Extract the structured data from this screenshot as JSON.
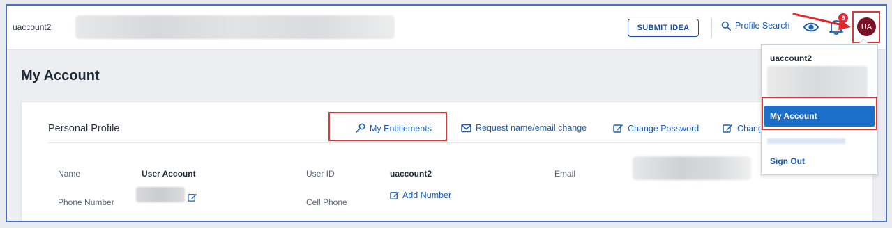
{
  "header": {
    "account_name": "uaccount2",
    "submit_idea_label": "SUBMIT IDEA",
    "profile_search_label": "Profile Search",
    "notification_count": "8",
    "avatar_initials": "UA"
  },
  "page": {
    "title": "My Account"
  },
  "profile": {
    "section_title": "Personal Profile",
    "actions": {
      "entitlements": "My Entitlements",
      "request_change": "Request name/email change",
      "change_password": "Change Password",
      "change_truncated": "Chang"
    },
    "fields": {
      "name_label": "Name",
      "name_value": "User Account",
      "userid_label": "User ID",
      "userid_value": "uaccount2",
      "email_label": "Email",
      "phone_label": "Phone Number",
      "cell_label": "Cell Phone",
      "add_number_label": "Add Number"
    }
  },
  "user_menu": {
    "username": "uaccount2",
    "my_account": "My Account",
    "sign_out": "Sign Out"
  },
  "colors": {
    "brand_blue": "#1b5fb3",
    "menu_highlight": "#1b6fc9",
    "avatar_bg": "#7a1127",
    "annotation_red": "#d43c3c",
    "badge_red": "#e0283a"
  }
}
